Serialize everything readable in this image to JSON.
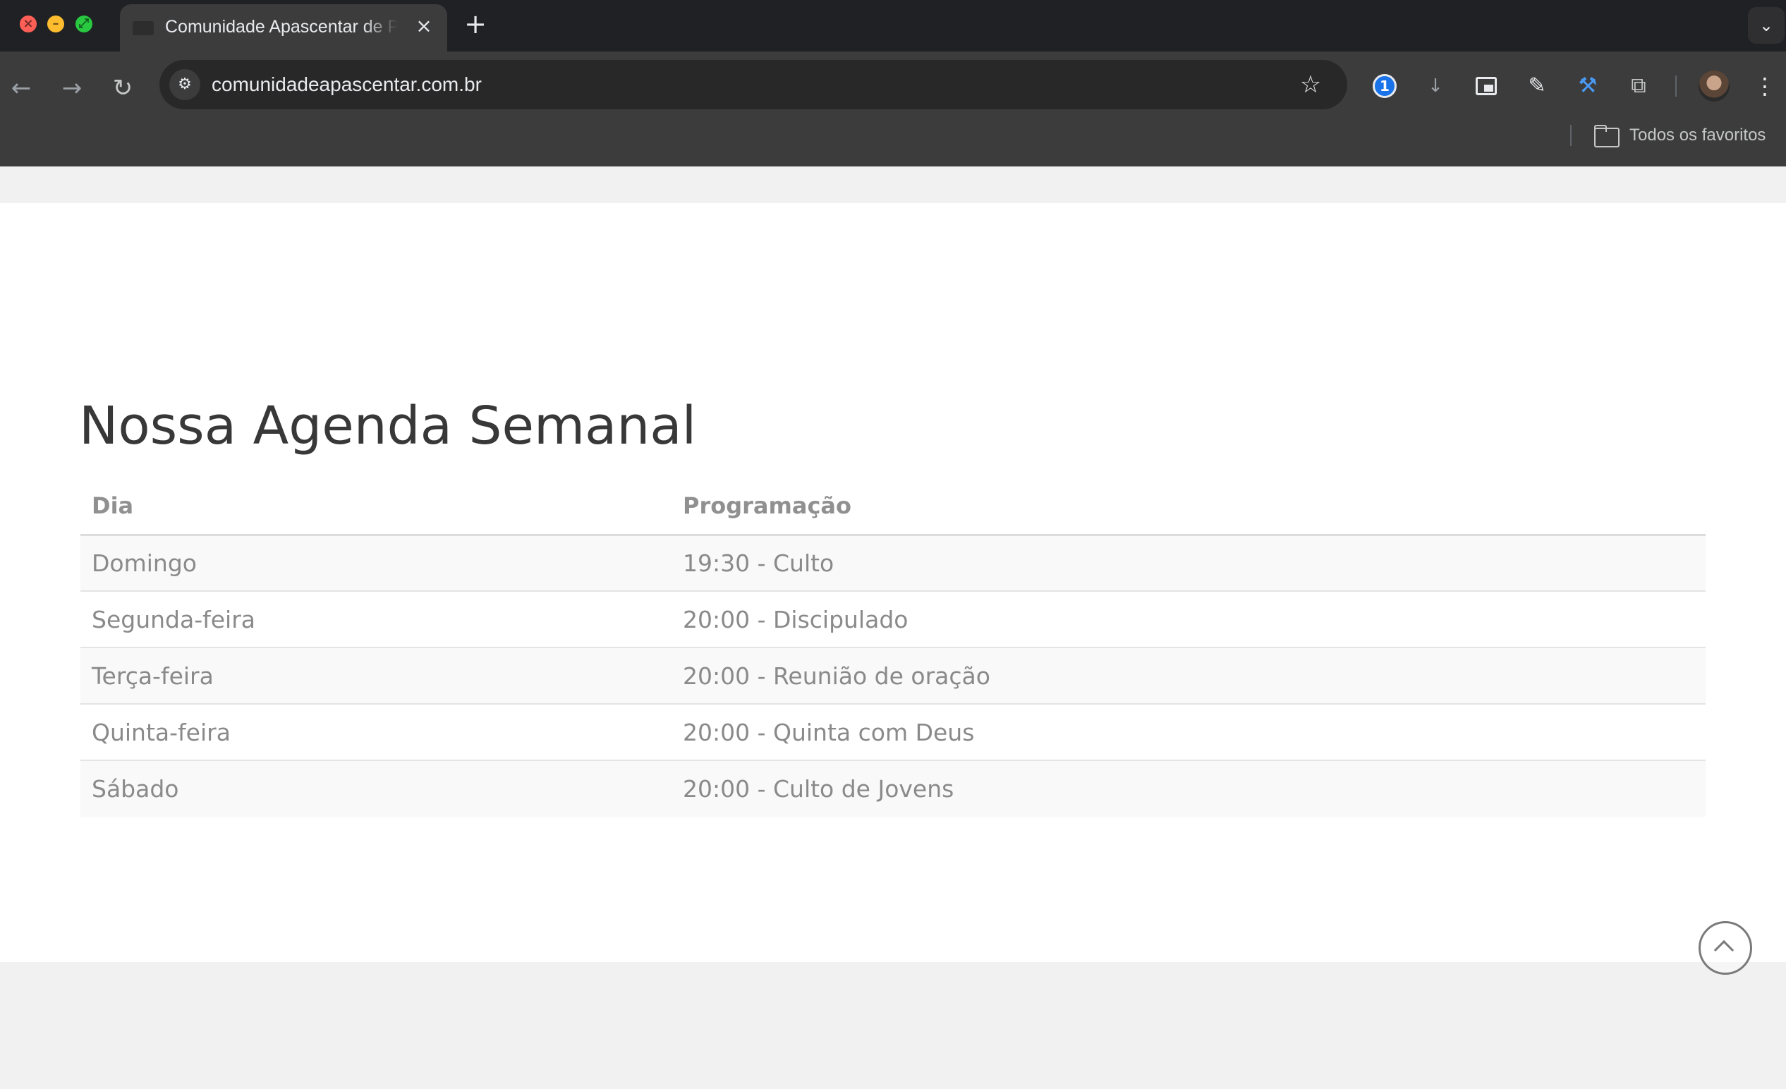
{
  "browser": {
    "tab": {
      "title": "Comunidade Apascentar de P"
    },
    "address_bar": {
      "url": "comunidadeapascentar.com.br"
    },
    "bookmarks_bar": {
      "all_bookmarks_label": "Todos os favoritos"
    },
    "icons": {
      "close_window": "close-icon",
      "minimize_window": "minimize-icon",
      "maximize_window": "fullscreen-icon",
      "tab_close": "close-icon",
      "new_tab": "plus-icon",
      "tab_search": "chevron-down-icon",
      "back": "arrow-left-icon",
      "forward": "arrow-right-icon",
      "reload": "reload-icon",
      "site_info": "tune-icon",
      "bookmark": "star-icon",
      "extensions": [
        "1password-icon",
        "download-icon",
        "picture-in-picture-icon",
        "eyedropper-icon",
        "hammer-icon",
        "puzzle-icon"
      ],
      "profile": "avatar",
      "menu": "kebab-menu-icon",
      "bookmarks_folder": "folder-icon"
    }
  },
  "page": {
    "title": "Nossa Agenda Semanal",
    "schedule": {
      "headers": {
        "day": "Dia",
        "program": "Programação"
      },
      "rows": [
        {
          "day": "Domingo",
          "program": "19:30 - Culto"
        },
        {
          "day": "Segunda-feira",
          "program": "20:00 - Discipulado"
        },
        {
          "day": "Terça-feira",
          "program": "20:00 - Reunião de oração"
        },
        {
          "day": "Quinta-feira",
          "program": "20:00 - Quinta com Deus"
        },
        {
          "day": "Sábado",
          "program": "20:00 - Culto de Jovens"
        }
      ]
    },
    "scroll_to_top": {
      "icon": "chevron-up-icon"
    }
  },
  "colors": {
    "chrome_tabbar": "#202124",
    "chrome_toolbar": "#3c3c3c",
    "omnibox": "#282828",
    "page_background": "#f1f1f1",
    "content_background": "#ffffff",
    "heading_text": "#383838",
    "table_text": "#8a8a8a",
    "accent_extension": "#4a9af5"
  }
}
